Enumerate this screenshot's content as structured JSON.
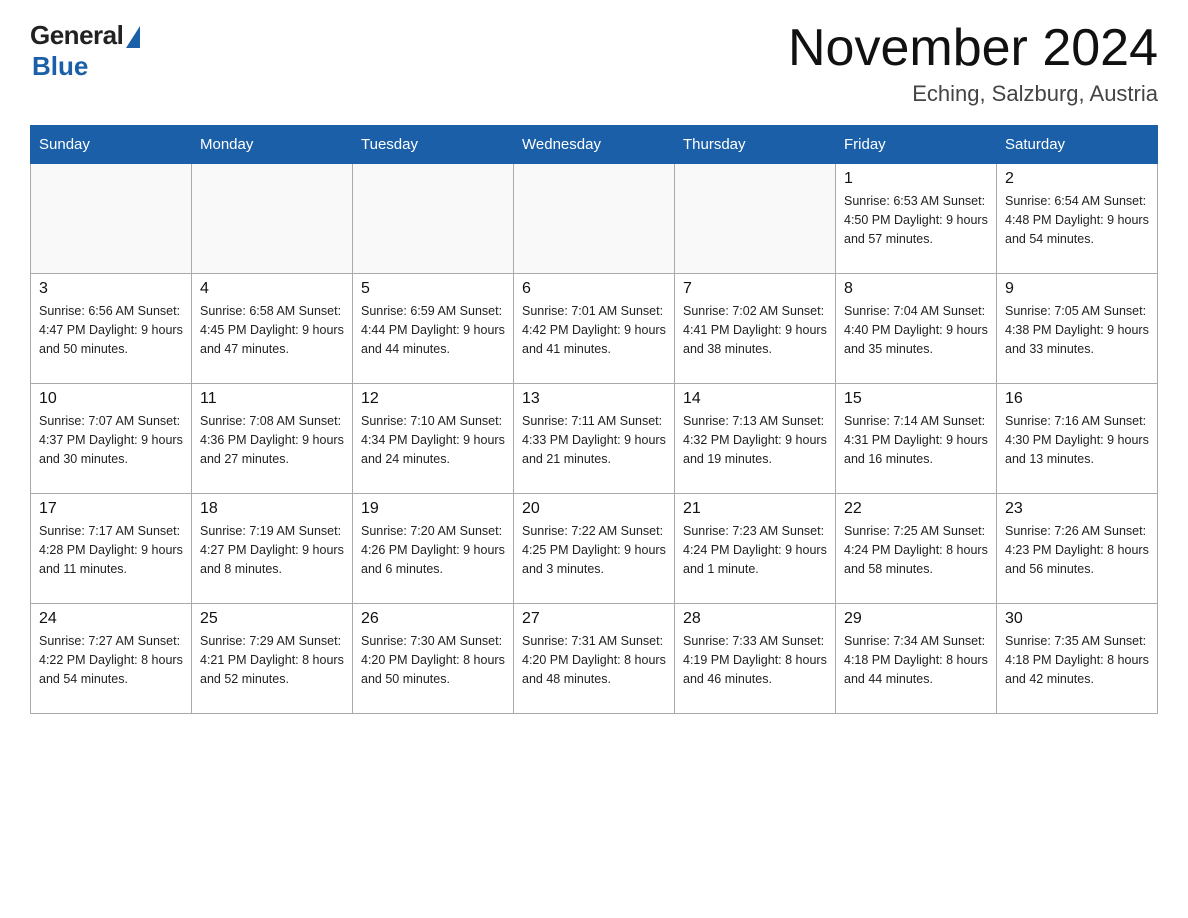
{
  "header": {
    "logo": {
      "general": "General",
      "blue": "Blue",
      "underline": "Blue"
    },
    "title": "November 2024",
    "subtitle": "Eching, Salzburg, Austria"
  },
  "weekdays": [
    "Sunday",
    "Monday",
    "Tuesday",
    "Wednesday",
    "Thursday",
    "Friday",
    "Saturday"
  ],
  "weeks": [
    [
      {
        "day": "",
        "info": ""
      },
      {
        "day": "",
        "info": ""
      },
      {
        "day": "",
        "info": ""
      },
      {
        "day": "",
        "info": ""
      },
      {
        "day": "",
        "info": ""
      },
      {
        "day": "1",
        "info": "Sunrise: 6:53 AM\nSunset: 4:50 PM\nDaylight: 9 hours and 57 minutes."
      },
      {
        "day": "2",
        "info": "Sunrise: 6:54 AM\nSunset: 4:48 PM\nDaylight: 9 hours and 54 minutes."
      }
    ],
    [
      {
        "day": "3",
        "info": "Sunrise: 6:56 AM\nSunset: 4:47 PM\nDaylight: 9 hours and 50 minutes."
      },
      {
        "day": "4",
        "info": "Sunrise: 6:58 AM\nSunset: 4:45 PM\nDaylight: 9 hours and 47 minutes."
      },
      {
        "day": "5",
        "info": "Sunrise: 6:59 AM\nSunset: 4:44 PM\nDaylight: 9 hours and 44 minutes."
      },
      {
        "day": "6",
        "info": "Sunrise: 7:01 AM\nSunset: 4:42 PM\nDaylight: 9 hours and 41 minutes."
      },
      {
        "day": "7",
        "info": "Sunrise: 7:02 AM\nSunset: 4:41 PM\nDaylight: 9 hours and 38 minutes."
      },
      {
        "day": "8",
        "info": "Sunrise: 7:04 AM\nSunset: 4:40 PM\nDaylight: 9 hours and 35 minutes."
      },
      {
        "day": "9",
        "info": "Sunrise: 7:05 AM\nSunset: 4:38 PM\nDaylight: 9 hours and 33 minutes."
      }
    ],
    [
      {
        "day": "10",
        "info": "Sunrise: 7:07 AM\nSunset: 4:37 PM\nDaylight: 9 hours and 30 minutes."
      },
      {
        "day": "11",
        "info": "Sunrise: 7:08 AM\nSunset: 4:36 PM\nDaylight: 9 hours and 27 minutes."
      },
      {
        "day": "12",
        "info": "Sunrise: 7:10 AM\nSunset: 4:34 PM\nDaylight: 9 hours and 24 minutes."
      },
      {
        "day": "13",
        "info": "Sunrise: 7:11 AM\nSunset: 4:33 PM\nDaylight: 9 hours and 21 minutes."
      },
      {
        "day": "14",
        "info": "Sunrise: 7:13 AM\nSunset: 4:32 PM\nDaylight: 9 hours and 19 minutes."
      },
      {
        "day": "15",
        "info": "Sunrise: 7:14 AM\nSunset: 4:31 PM\nDaylight: 9 hours and 16 minutes."
      },
      {
        "day": "16",
        "info": "Sunrise: 7:16 AM\nSunset: 4:30 PM\nDaylight: 9 hours and 13 minutes."
      }
    ],
    [
      {
        "day": "17",
        "info": "Sunrise: 7:17 AM\nSunset: 4:28 PM\nDaylight: 9 hours and 11 minutes."
      },
      {
        "day": "18",
        "info": "Sunrise: 7:19 AM\nSunset: 4:27 PM\nDaylight: 9 hours and 8 minutes."
      },
      {
        "day": "19",
        "info": "Sunrise: 7:20 AM\nSunset: 4:26 PM\nDaylight: 9 hours and 6 minutes."
      },
      {
        "day": "20",
        "info": "Sunrise: 7:22 AM\nSunset: 4:25 PM\nDaylight: 9 hours and 3 minutes."
      },
      {
        "day": "21",
        "info": "Sunrise: 7:23 AM\nSunset: 4:24 PM\nDaylight: 9 hours and 1 minute."
      },
      {
        "day": "22",
        "info": "Sunrise: 7:25 AM\nSunset: 4:24 PM\nDaylight: 8 hours and 58 minutes."
      },
      {
        "day": "23",
        "info": "Sunrise: 7:26 AM\nSunset: 4:23 PM\nDaylight: 8 hours and 56 minutes."
      }
    ],
    [
      {
        "day": "24",
        "info": "Sunrise: 7:27 AM\nSunset: 4:22 PM\nDaylight: 8 hours and 54 minutes."
      },
      {
        "day": "25",
        "info": "Sunrise: 7:29 AM\nSunset: 4:21 PM\nDaylight: 8 hours and 52 minutes."
      },
      {
        "day": "26",
        "info": "Sunrise: 7:30 AM\nSunset: 4:20 PM\nDaylight: 8 hours and 50 minutes."
      },
      {
        "day": "27",
        "info": "Sunrise: 7:31 AM\nSunset: 4:20 PM\nDaylight: 8 hours and 48 minutes."
      },
      {
        "day": "28",
        "info": "Sunrise: 7:33 AM\nSunset: 4:19 PM\nDaylight: 8 hours and 46 minutes."
      },
      {
        "day": "29",
        "info": "Sunrise: 7:34 AM\nSunset: 4:18 PM\nDaylight: 8 hours and 44 minutes."
      },
      {
        "day": "30",
        "info": "Sunrise: 7:35 AM\nSunset: 4:18 PM\nDaylight: 8 hours and 42 minutes."
      }
    ]
  ]
}
